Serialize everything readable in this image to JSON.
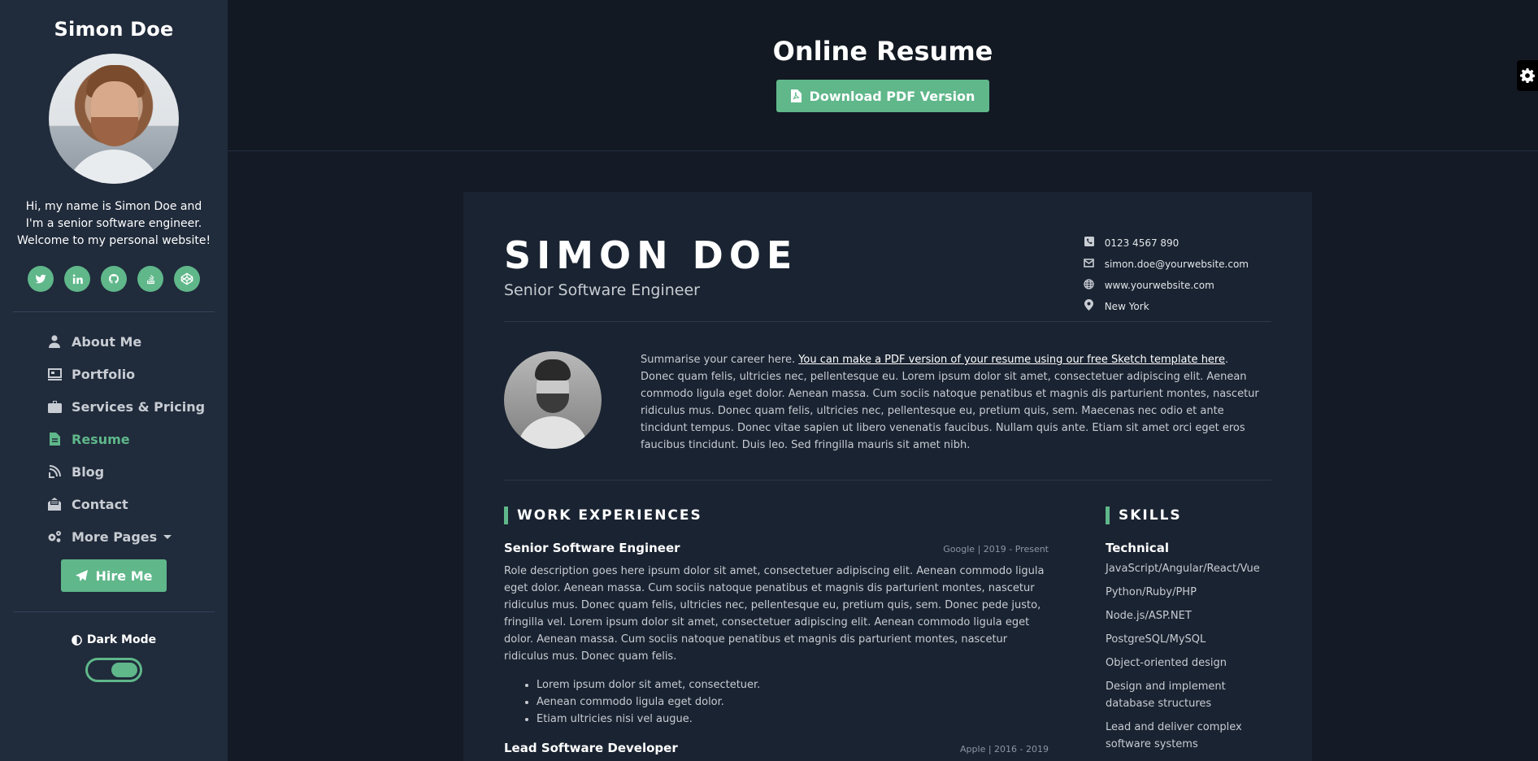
{
  "sidebar": {
    "name": "Simon Doe",
    "bio": "Hi, my name is Simon Doe and I'm a senior software engineer. Welcome to my personal website!",
    "socials": [
      {
        "icon": "twitter-icon",
        "glyph": "t"
      },
      {
        "icon": "linkedin-icon",
        "glyph": "in"
      },
      {
        "icon": "github-icon",
        "glyph": "gh"
      },
      {
        "icon": "stackoverflow-icon",
        "glyph": "so"
      },
      {
        "icon": "codepen-icon",
        "glyph": "cp"
      }
    ],
    "nav": [
      {
        "label": "About Me",
        "icon": "user-icon"
      },
      {
        "label": "Portfolio",
        "icon": "laptop-icon"
      },
      {
        "label": "Services & Pricing",
        "icon": "briefcase-icon"
      },
      {
        "label": "Resume",
        "icon": "file-icon",
        "active": true
      },
      {
        "label": "Blog",
        "icon": "blog-icon"
      },
      {
        "label": "Contact",
        "icon": "envelope-open-icon"
      },
      {
        "label": "More Pages",
        "icon": "cogs-icon"
      }
    ],
    "hire_label": "Hire Me",
    "dark_mode_label": "Dark Mode"
  },
  "header": {
    "title": "Online Resume",
    "download_label": "Download PDF Version"
  },
  "resume": {
    "name": "SIMON DOE",
    "role": "Senior Software Engineer",
    "contacts": {
      "phone": "0123 4567 890",
      "email": "simon.doe@yourwebsite.com",
      "website": "www.yourwebsite.com",
      "location": "New York"
    },
    "summary": {
      "lead": "Summarise your career here. ",
      "link": "You can make a PDF version of your resume using our free Sketch template here",
      "rest": ". Donec quam felis, ultricies nec, pellentesque eu. Lorem ipsum dolor sit amet, consectetuer adipiscing elit. Aenean commodo ligula eget dolor. Aenean massa. Cum sociis natoque penatibus et magnis dis parturient montes, nascetur ridiculus mus. Donec quam felis, ultricies nec, pellentesque eu, pretium quis, sem. Maecenas nec odio et ante tincidunt tempus. Donec vitae sapien ut libero venenatis faucibus. Nullam quis ante. Etiam sit amet orci eget eros faucibus tincidunt. Duis leo. Sed fringilla mauris sit amet nibh."
    },
    "work_title": "WORK EXPERIENCES",
    "jobs": [
      {
        "title": "Senior Software Engineer",
        "meta": "Google | 2019 - Present",
        "desc": "Role description goes here ipsum dolor sit amet, consectetuer adipiscing elit. Aenean commodo ligula eget dolor. Aenean massa. Cum sociis natoque penatibus et magnis dis parturient montes, nascetur ridiculus mus. Donec quam felis, ultricies nec, pellentesque eu, pretium quis, sem. Donec pede justo, fringilla vel. Lorem ipsum dolor sit amet, consectetuer adipiscing elit. Aenean commodo ligula eget dolor. Aenean massa. Cum sociis natoque penatibus et magnis dis parturient montes, nascetur ridiculus mus. Donec quam felis.",
        "bullets": [
          "Lorem ipsum dolor sit amet, consectetuer.",
          "Aenean commodo ligula eget dolor.",
          "Etiam ultricies nisi vel augue."
        ]
      },
      {
        "title": "Lead Software Developer",
        "meta": "Apple | 2016 - 2019"
      }
    ],
    "skills_title": "SKILLS",
    "skill_group": "Technical",
    "skills": [
      "JavaScript/Angular/React/Vue",
      "Python/Ruby/PHP",
      "Node.js/ASP.NET",
      "PostgreSQL/MySQL",
      "Object-oriented design",
      "Design and implement database structures",
      "Lead and deliver complex software systems"
    ]
  },
  "colors": {
    "accent": "#5fb78a",
    "sidebar_bg": "#202b3b",
    "page_bg": "#141b26",
    "card_bg": "#1a2331"
  }
}
